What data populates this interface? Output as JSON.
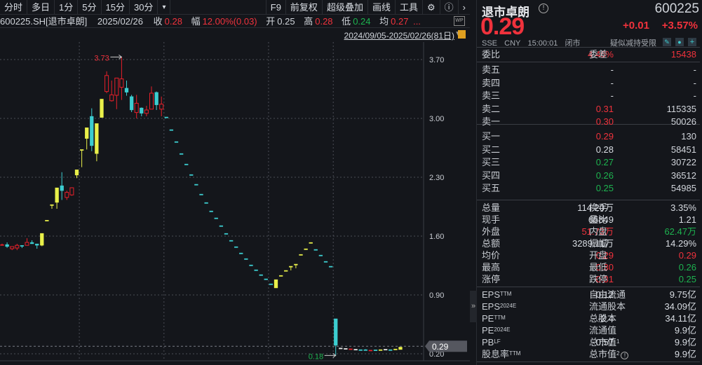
{
  "toolbar": {
    "left": [
      "分时",
      "多日",
      "1分",
      "5分",
      "15分",
      "30分"
    ],
    "more": "▾",
    "right": [
      "F9",
      "前复权",
      "超级叠加",
      "画线",
      "工具"
    ]
  },
  "info": {
    "code": "600225.SH[退市卓朗]",
    "date": "2025/02/26",
    "close_label": "收",
    "close": "0.28",
    "amp_label": "幅",
    "amp": "12.00%(0.03)",
    "open_label": "开",
    "open": "0.25",
    "high_label": "高",
    "high": "0.28",
    "low_label": "低",
    "low": "0.24",
    "avg_label": "均",
    "avg": "0.27",
    "ellipsis": "...",
    "wp": "WP"
  },
  "range": "2024/09/05-2025/02/26(81日)",
  "quote": {
    "name": "退市卓朗",
    "code": "600225",
    "price": "0.29",
    "change": "+0.01",
    "change_pct": "+3.57%",
    "exchange": "SSE",
    "currency": "CNY",
    "time": "15:00:01",
    "status": "闭市",
    "notice": "疑似减持受限",
    "weibi_label": "委比",
    "weibi": "4.46%",
    "weicha_label": "委差",
    "weicha": "15438"
  },
  "order_book": {
    "asks": [
      {
        "label": "卖五",
        "price": "-",
        "vol": "-",
        "c": "white"
      },
      {
        "label": "卖四",
        "price": "-",
        "vol": "-",
        "c": "white"
      },
      {
        "label": "卖三",
        "price": "-",
        "vol": "-",
        "c": "white"
      },
      {
        "label": "卖二",
        "price": "0.31",
        "vol": "115335",
        "c": "red"
      },
      {
        "label": "卖一",
        "price": "0.30",
        "vol": "50026",
        "c": "red"
      }
    ],
    "bids": [
      {
        "label": "买一",
        "price": "0.29",
        "vol": "130",
        "c": "red"
      },
      {
        "label": "买二",
        "price": "0.28",
        "vol": "58451",
        "c": "white"
      },
      {
        "label": "买三",
        "price": "0.27",
        "vol": "30722",
        "c": "green"
      },
      {
        "label": "买四",
        "price": "0.26",
        "vol": "36512",
        "c": "green"
      },
      {
        "label": "买五",
        "price": "0.25",
        "vol": "54985",
        "c": "green"
      }
    ]
  },
  "stats": [
    {
      "l1": "总量",
      "v1": "114.20万",
      "c1": "white",
      "l2": "换手",
      "v2": "3.35%",
      "c2": "white"
    },
    {
      "l1": "现手",
      "v1": "65849",
      "c1": "white",
      "l2": "量比",
      "v2": "1.21",
      "c2": "white"
    },
    {
      "l1": "外盘",
      "v1": "51.73万",
      "c1": "red",
      "l2": "内盘",
      "v2": "62.47万",
      "c2": "green"
    },
    {
      "l1": "总额",
      "v1": "3289.11万",
      "c1": "white",
      "l2": "振幅",
      "v2": "14.29%",
      "c2": "white"
    },
    {
      "l1": "均价",
      "v1": "0.29",
      "c1": "red",
      "l2": "开盘",
      "v2": "0.29",
      "c2": "red"
    },
    {
      "l1": "最高",
      "v1": "0.30",
      "c1": "red",
      "l2": "最低",
      "v2": "0.26",
      "c2": "green"
    },
    {
      "l1": "涨停",
      "v1": "0.31",
      "c1": "red",
      "l2": "跌停",
      "v2": "0.25",
      "c2": "green"
    }
  ],
  "fundamentals": [
    {
      "l1": "EPS",
      "s1": "TTM",
      "v1": "-0.12",
      "l2": "自由流通",
      "s2": "",
      "v2": "9.75亿"
    },
    {
      "l1": "EPS",
      "s1": "2024E",
      "v1": "",
      "l2": "流通股本",
      "s2": "",
      "v2": "34.09亿"
    },
    {
      "l1": "PE",
      "s1": "TTM",
      "v1": "-2.4",
      "l2": "总股本",
      "s2": "",
      "v2": "34.11亿"
    },
    {
      "l1": "PE",
      "s1": "2024E",
      "v1": "-",
      "l2": "流通值",
      "s2": "",
      "v2": "9.9亿"
    },
    {
      "l1": "PB",
      "s1": "LF",
      "v1": "0.57",
      "l2": "总市值",
      "s2": "1",
      "v2": "9.9亿"
    },
    {
      "l1": "股息率",
      "s1": "TTM",
      "v1": "-",
      "l2": "总市值",
      "s2": "2",
      "v2": "9.9亿"
    }
  ],
  "colors": {
    "up": "#e8202a",
    "down": "#3ccdd0",
    "limit": "#e9f04a",
    "flat": "#e6e6e6",
    "red": "#f0323c",
    "green": "#1db34f"
  },
  "chart_data": {
    "type": "candlestick",
    "y_ticks": [
      "3.70",
      "3.00",
      "2.30",
      "1.60",
      "0.90",
      "0.20"
    ],
    "ylim": [
      0.16,
      3.8
    ],
    "max_label": "3.73",
    "min_label": "0.18",
    "last_price": "0.29",
    "month_breaks": [
      16,
      33,
      54,
      67
    ],
    "candles": [
      [
        1.5,
        1.51,
        1.49,
        1.5,
        "u"
      ],
      [
        1.5,
        1.525,
        1.46,
        1.475,
        "d"
      ],
      [
        1.45,
        1.46,
        1.433,
        1.475,
        "u"
      ],
      [
        1.458,
        1.508,
        1.433,
        1.49,
        "u"
      ],
      [
        1.49,
        1.49,
        1.458,
        1.49,
        "d"
      ],
      [
        1.49,
        1.575,
        1.49,
        1.525,
        "u"
      ],
      [
        1.525,
        1.55,
        1.51,
        1.508,
        "d"
      ],
      [
        1.508,
        1.508,
        1.45,
        1.49,
        "d"
      ],
      [
        1.49,
        1.633,
        1.48,
        1.633,
        "l"
      ],
      [
        1.79,
        1.79,
        1.79,
        1.79,
        "l"
      ],
      [
        1.975,
        1.975,
        1.925,
        1.975,
        "l"
      ],
      [
        2.0,
        2.175,
        1.925,
        2.175,
        "l"
      ],
      [
        2.2,
        2.36,
        2.03,
        2.14,
        "d"
      ],
      [
        2.06,
        2.14,
        2.03,
        2.12,
        "u"
      ],
      [
        2.09,
        2.18,
        2.08,
        2.175,
        "u"
      ],
      [
        2.325,
        2.39,
        2.29,
        2.39,
        "l"
      ],
      [
        2.63,
        2.63,
        2.42,
        2.63,
        "l"
      ],
      [
        2.76,
        2.89,
        2.63,
        2.89,
        "l"
      ],
      [
        3.025,
        3.12,
        2.61,
        2.675,
        "d"
      ],
      [
        2.94,
        2.94,
        2.49,
        2.58,
        "l"
      ],
      [
        3.01,
        3.23,
        3.01,
        3.23,
        "l"
      ],
      [
        3.32,
        3.56,
        3.3,
        3.51,
        "u"
      ],
      [
        3.21,
        3.45,
        3.2,
        3.28,
        "u"
      ],
      [
        3.275,
        3.48,
        3.11,
        3.48,
        "u"
      ],
      [
        3.37,
        3.73,
        3.22,
        3.47,
        "u"
      ],
      [
        3.36,
        3.45,
        3.27,
        3.31,
        "d"
      ],
      [
        3.26,
        3.28,
        3.075,
        3.1,
        "d"
      ],
      [
        3.07,
        3.28,
        3.0,
        3.18,
        "u"
      ],
      [
        3.125,
        3.13,
        3.025,
        3.06,
        "d"
      ],
      [
        3.06,
        3.15,
        3.025,
        3.1,
        "u"
      ],
      [
        3.11,
        3.38,
        3.11,
        3.3,
        "u"
      ],
      [
        3.31,
        3.32,
        3.1,
        3.16,
        "d"
      ],
      [
        3.11,
        3.26,
        3.025,
        3.17,
        "u"
      ],
      [
        3.017,
        3.017,
        3.017,
        3.017,
        "d"
      ],
      [
        2.867,
        2.867,
        2.867,
        2.867,
        "d"
      ],
      [
        2.725,
        2.725,
        2.725,
        2.725,
        "d"
      ],
      [
        2.583,
        2.583,
        2.583,
        2.583,
        "d"
      ],
      [
        2.458,
        2.458,
        2.458,
        2.458,
        "d"
      ],
      [
        2.333,
        2.333,
        2.333,
        2.333,
        "d"
      ],
      [
        2.217,
        2.217,
        2.217,
        2.217,
        "d"
      ],
      [
        2.1,
        2.1,
        2.1,
        2.1,
        "d"
      ],
      [
        2.0,
        2.0,
        2.0,
        2.0,
        "d"
      ],
      [
        1.9,
        1.9,
        1.9,
        1.9,
        "d"
      ],
      [
        1.817,
        1.817,
        1.817,
        1.817,
        "d"
      ],
      [
        1.725,
        1.725,
        1.725,
        1.725,
        "d"
      ],
      [
        1.633,
        1.633,
        1.633,
        1.633,
        "d"
      ],
      [
        1.55,
        1.55,
        1.55,
        1.55,
        "d"
      ],
      [
        1.475,
        1.475,
        1.475,
        1.475,
        "d"
      ],
      [
        1.4,
        1.4,
        1.4,
        1.4,
        "d"
      ],
      [
        1.333,
        1.333,
        1.333,
        1.333,
        "d"
      ],
      [
        1.258,
        1.258,
        1.258,
        1.258,
        "d"
      ],
      [
        1.2,
        1.2,
        1.2,
        1.2,
        "d"
      ],
      [
        1.142,
        1.142,
        1.142,
        1.142,
        "d"
      ],
      [
        1.092,
        1.092,
        1.092,
        1.092,
        "d"
      ],
      [
        1.033,
        1.033,
        1.033,
        1.033,
        "d"
      ],
      [
        0.983,
        1.083,
        0.983,
        1.083,
        "l"
      ],
      [
        1.133,
        1.133,
        1.133,
        1.133,
        "l"
      ],
      [
        1.192,
        1.192,
        1.192,
        1.192,
        "l"
      ],
      [
        1.242,
        1.242,
        1.192,
        1.242,
        "l"
      ],
      [
        1.267,
        1.267,
        1.217,
        1.267,
        "l"
      ],
      [
        1.383,
        1.383,
        1.383,
        1.383,
        "l"
      ],
      [
        1.45,
        1.45,
        1.45,
        1.45,
        "l"
      ],
      [
        1.525,
        1.525,
        1.525,
        1.525,
        "l"
      ],
      [
        1.442,
        1.442,
        1.442,
        1.442,
        "d"
      ],
      [
        1.375,
        1.375,
        1.375,
        1.375,
        "d"
      ],
      [
        1.3,
        1.3,
        1.3,
        1.3,
        "d"
      ],
      [
        1.242,
        1.242,
        1.242,
        1.242,
        "d"
      ],
      [
        0.617,
        0.617,
        0.18,
        0.3,
        "d"
      ],
      [
        0.27,
        0.27,
        0.26,
        0.27,
        "f"
      ],
      [
        0.265,
        0.265,
        0.255,
        0.265,
        "f"
      ],
      [
        0.26,
        0.26,
        0.25,
        0.26,
        "u"
      ],
      [
        0.255,
        0.255,
        0.25,
        0.255,
        "f"
      ],
      [
        0.25,
        0.25,
        0.25,
        0.25,
        "d"
      ],
      [
        0.25,
        0.255,
        0.245,
        0.245,
        "d"
      ],
      [
        0.245,
        0.245,
        0.235,
        0.245,
        "u"
      ],
      [
        0.248,
        0.248,
        0.242,
        0.242,
        "d"
      ],
      [
        0.25,
        0.25,
        0.24,
        0.25,
        "l"
      ],
      [
        0.255,
        0.255,
        0.25,
        0.255,
        "f"
      ],
      [
        0.25,
        0.25,
        0.25,
        0.25,
        "d"
      ],
      [
        0.258,
        0.258,
        0.252,
        0.258,
        "l"
      ],
      [
        0.25,
        0.28,
        0.25,
        0.28,
        "l"
      ]
    ]
  }
}
